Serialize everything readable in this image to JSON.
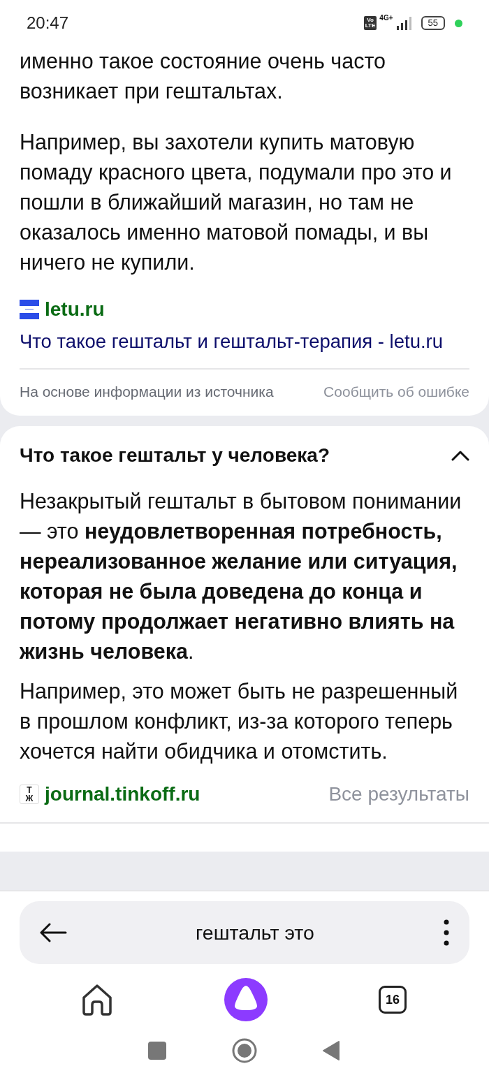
{
  "status_bar": {
    "time": "20:47",
    "volte": [
      "Vo",
      "LTE"
    ],
    "network": "4G+",
    "battery": "55"
  },
  "cards": [
    {
      "kind": "answer",
      "paragraphs": [
        "именно такое состояние очень часто возникает при гештальтах.",
        "Например, вы захотели купить матовую помаду красного цвета, подумали про это и пошли в ближайший магазин, но там не оказалось именно матовой помады, и вы ничего не купили."
      ],
      "source": {
        "site": "letu.ru",
        "title": "Что такое гештальт и гештальт-терапия - letu.ru"
      },
      "footer": {
        "note": "На основе информации из источника",
        "report": "Сообщить об ошибке"
      }
    },
    {
      "kind": "question",
      "question": "Что такое гештальт у человека?",
      "expanded": true,
      "paragraphs": [
        "Незакрытый гештальт в бытовом понимании — это **неудовлетворенная потребность, нереализованное желание или ситуация, которая не была доведена до конца и потому продолжает негативно влиять на жизнь человека**.",
        "Например, это может быть не разрешенный в прошлом конфликт, из-за которого теперь хочется найти обидчика и отомстить."
      ],
      "source": {
        "site": "journal.tinkoff.ru",
        "icon_letters": [
          "Т",
          "Ж"
        ]
      },
      "all_results": "Все результаты"
    }
  ],
  "search_bar": {
    "query": "гештальт это"
  },
  "tabs_count": "16"
}
